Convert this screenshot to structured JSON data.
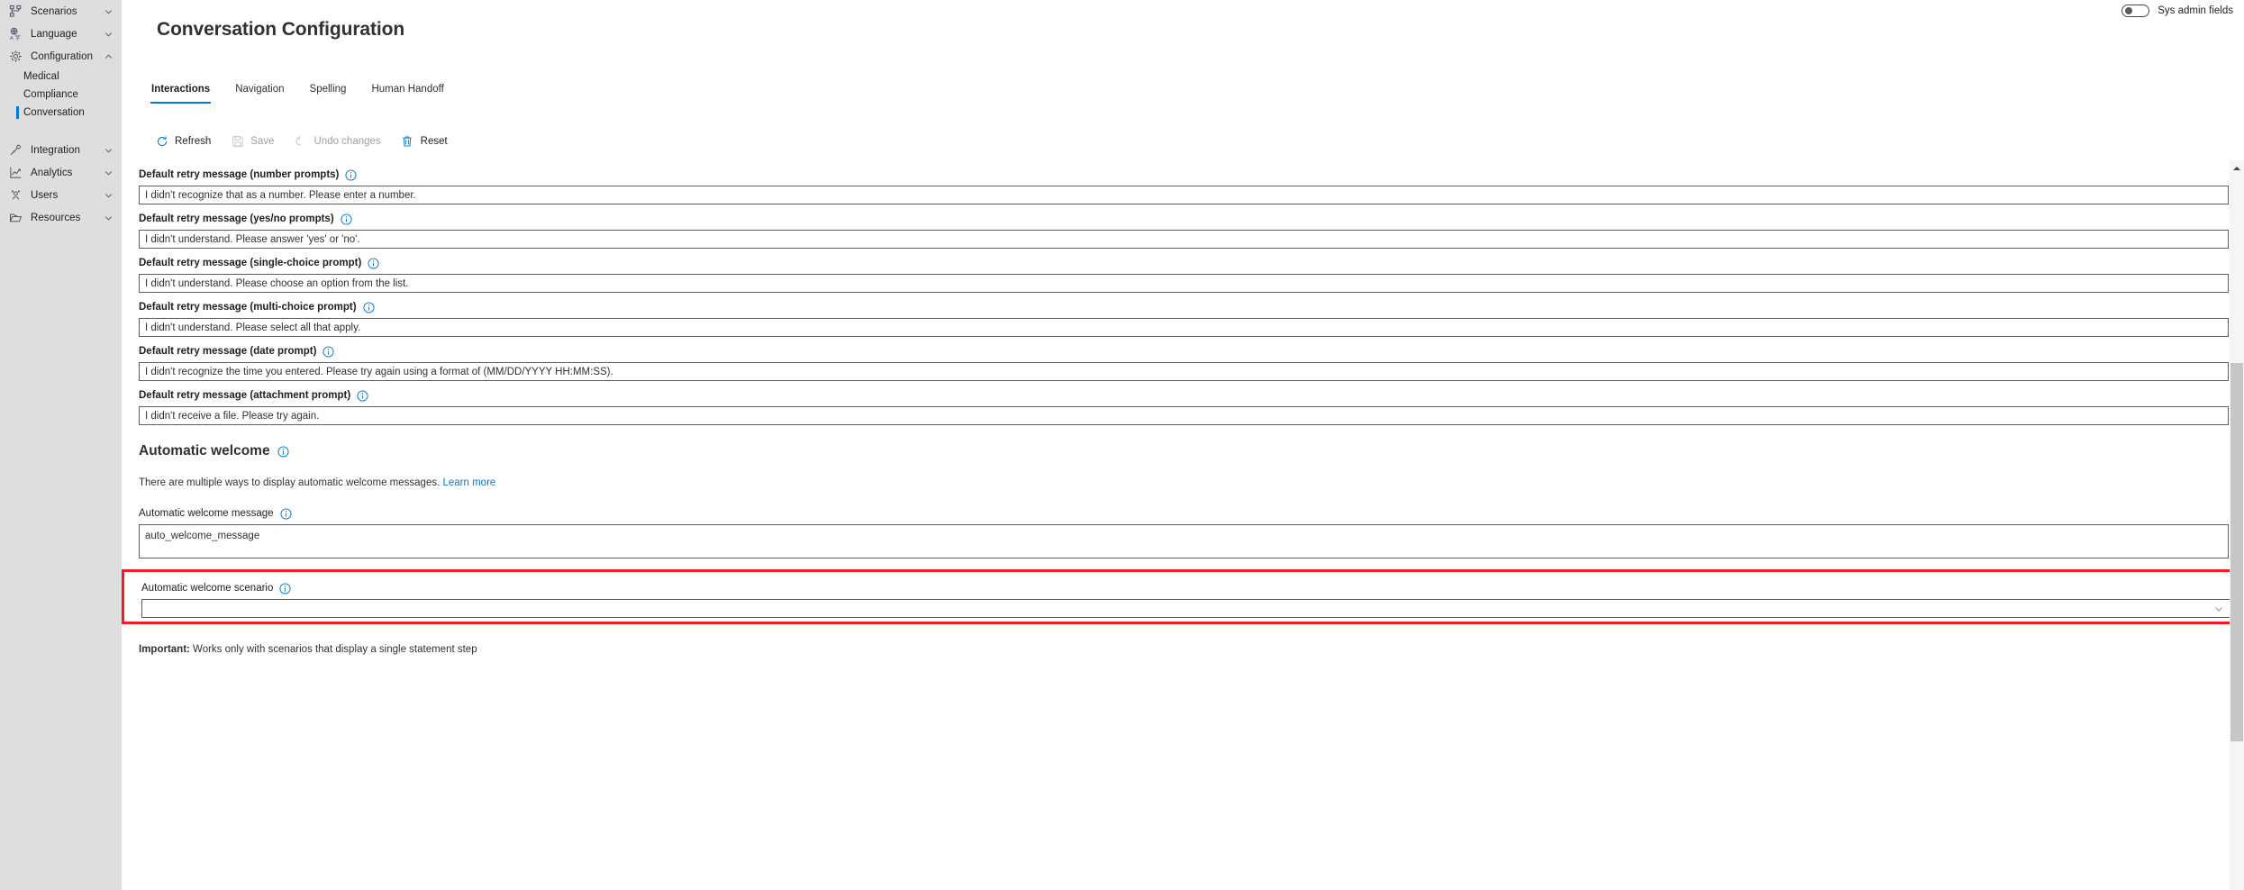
{
  "sidebar": {
    "items": [
      {
        "label": "Scenarios",
        "icon": "sitemap-icon",
        "chevron": "chevron-down",
        "expanded": false
      },
      {
        "label": "Language",
        "icon": "translate-icon",
        "chevron": "chevron-down",
        "expanded": false
      },
      {
        "label": "Configuration",
        "icon": "gear-icon",
        "chevron": "chevron-up",
        "expanded": true
      },
      {
        "label": "Integration",
        "icon": "plug-icon",
        "chevron": "chevron-down",
        "expanded": false
      },
      {
        "label": "Analytics",
        "icon": "chart-line-icon",
        "chevron": "chevron-down",
        "expanded": false
      },
      {
        "label": "Users",
        "icon": "people-icon",
        "chevron": "chevron-down",
        "expanded": false
      },
      {
        "label": "Resources",
        "icon": "folder-icon",
        "chevron": "chevron-down",
        "expanded": false
      }
    ],
    "configuration_children": [
      {
        "label": "Medical",
        "selected": false
      },
      {
        "label": "Compliance",
        "selected": false
      },
      {
        "label": "Conversation",
        "selected": true
      }
    ],
    "background_color": "#dedede",
    "selected_marker_color": "#0078d4"
  },
  "header": {
    "sys_admin_toggle_label": "Sys admin fields",
    "sys_admin_toggle_state": "off",
    "page_title": "Conversation Configuration"
  },
  "tabs": [
    {
      "label": "Interactions",
      "active": true
    },
    {
      "label": "Navigation",
      "active": false
    },
    {
      "label": "Spelling",
      "active": false
    },
    {
      "label": "Human Handoff",
      "active": false
    }
  ],
  "toolbar": {
    "buttons": [
      {
        "label": "Refresh",
        "icon": "refresh-icon",
        "disabled": false
      },
      {
        "label": "Save",
        "icon": "save-icon",
        "disabled": true
      },
      {
        "label": "Undo changes",
        "icon": "undo-icon",
        "disabled": true
      },
      {
        "label": "Reset",
        "icon": "trash-icon",
        "disabled": false
      }
    ]
  },
  "form": {
    "fields": [
      {
        "label": "Default retry message (number prompts)",
        "value": "I didn't recognize that as a number. Please enter a number.",
        "info": "info-icon"
      },
      {
        "label": "Default retry message (yes/no prompts)",
        "value": "I didn't understand. Please answer 'yes' or 'no'.",
        "info": "info-icon"
      },
      {
        "label": "Default retry message (single-choice prompt)",
        "value": "I didn't understand. Please choose an option from the list.",
        "info": "info-icon"
      },
      {
        "label": "Default retry message (multi-choice prompt)",
        "value": "I didn't understand. Please select all that apply.",
        "info": "info-icon"
      },
      {
        "label": "Default retry message (date prompt)",
        "value": "I didn't recognize the time you entered. Please try again using a format of (MM/DD/YYYY HH:MM:SS).",
        "info": "info-icon"
      },
      {
        "label": "Default retry message (attachment prompt)",
        "value": "I didn't receive a file. Please try again.",
        "info": "info-icon"
      }
    ],
    "automatic_welcome": {
      "section_title": "Automatic welcome",
      "helper_text": "There are multiple ways to display automatic welcome messages.",
      "learn_more_label": "Learn more",
      "message_label": "Automatic welcome message",
      "message_value": "auto_welcome_message",
      "scenario_label": "Automatic welcome scenario",
      "scenario_value": "",
      "scenario_placeholder": "",
      "important_prefix": "Important:",
      "important_text": " Works only with scenarios that display a single statement step",
      "highlight_color": "#ee1c25"
    }
  },
  "scrollbar": {
    "orientation": "vertical",
    "arrow_up": "triangle-up-icon"
  },
  "colors": {
    "accent": "#0078d4",
    "text": "#201f1e",
    "muted": "#a19f9d",
    "highlight": "#ee1c25"
  }
}
